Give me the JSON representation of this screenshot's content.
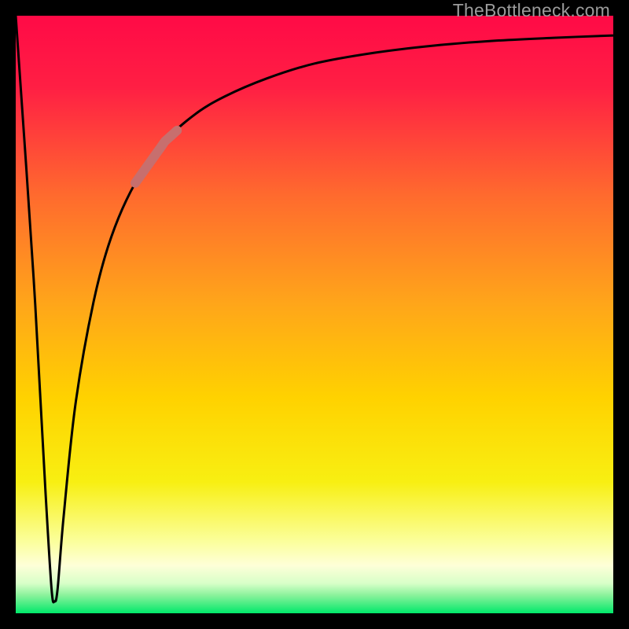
{
  "watermark": "TheBottleneck.com",
  "colors": {
    "black": "#000000",
    "red_top": "#ff0a46",
    "yellow_mid": "#ffe100",
    "pale_yellow": "#feffc6",
    "green_bottom": "#00e86a",
    "curve": "#000000",
    "highlight": "#c76f6e"
  },
  "chart_data": {
    "type": "line",
    "title": "",
    "xlabel": "",
    "ylabel": "",
    "xlim": [
      0,
      100
    ],
    "ylim": [
      0,
      100
    ],
    "grid": false,
    "series": [
      {
        "name": "bottleneck-curve",
        "x": [
          0,
          3,
          5,
          6,
          6.5,
          7,
          8,
          10,
          13,
          16,
          20,
          25,
          30,
          35,
          42,
          50,
          60,
          70,
          80,
          90,
          100
        ],
        "values": [
          100,
          56,
          20,
          4,
          2,
          4,
          16,
          35,
          52,
          63,
          72,
          79,
          83.5,
          86.5,
          89.5,
          92,
          93.8,
          95,
          95.8,
          96.3,
          96.7
        ]
      }
    ],
    "highlight_segment": {
      "series": "bottleneck-curve",
      "x_start": 20,
      "x_end": 27,
      "approx_y_start": 72,
      "approx_y_end": 80
    }
  }
}
